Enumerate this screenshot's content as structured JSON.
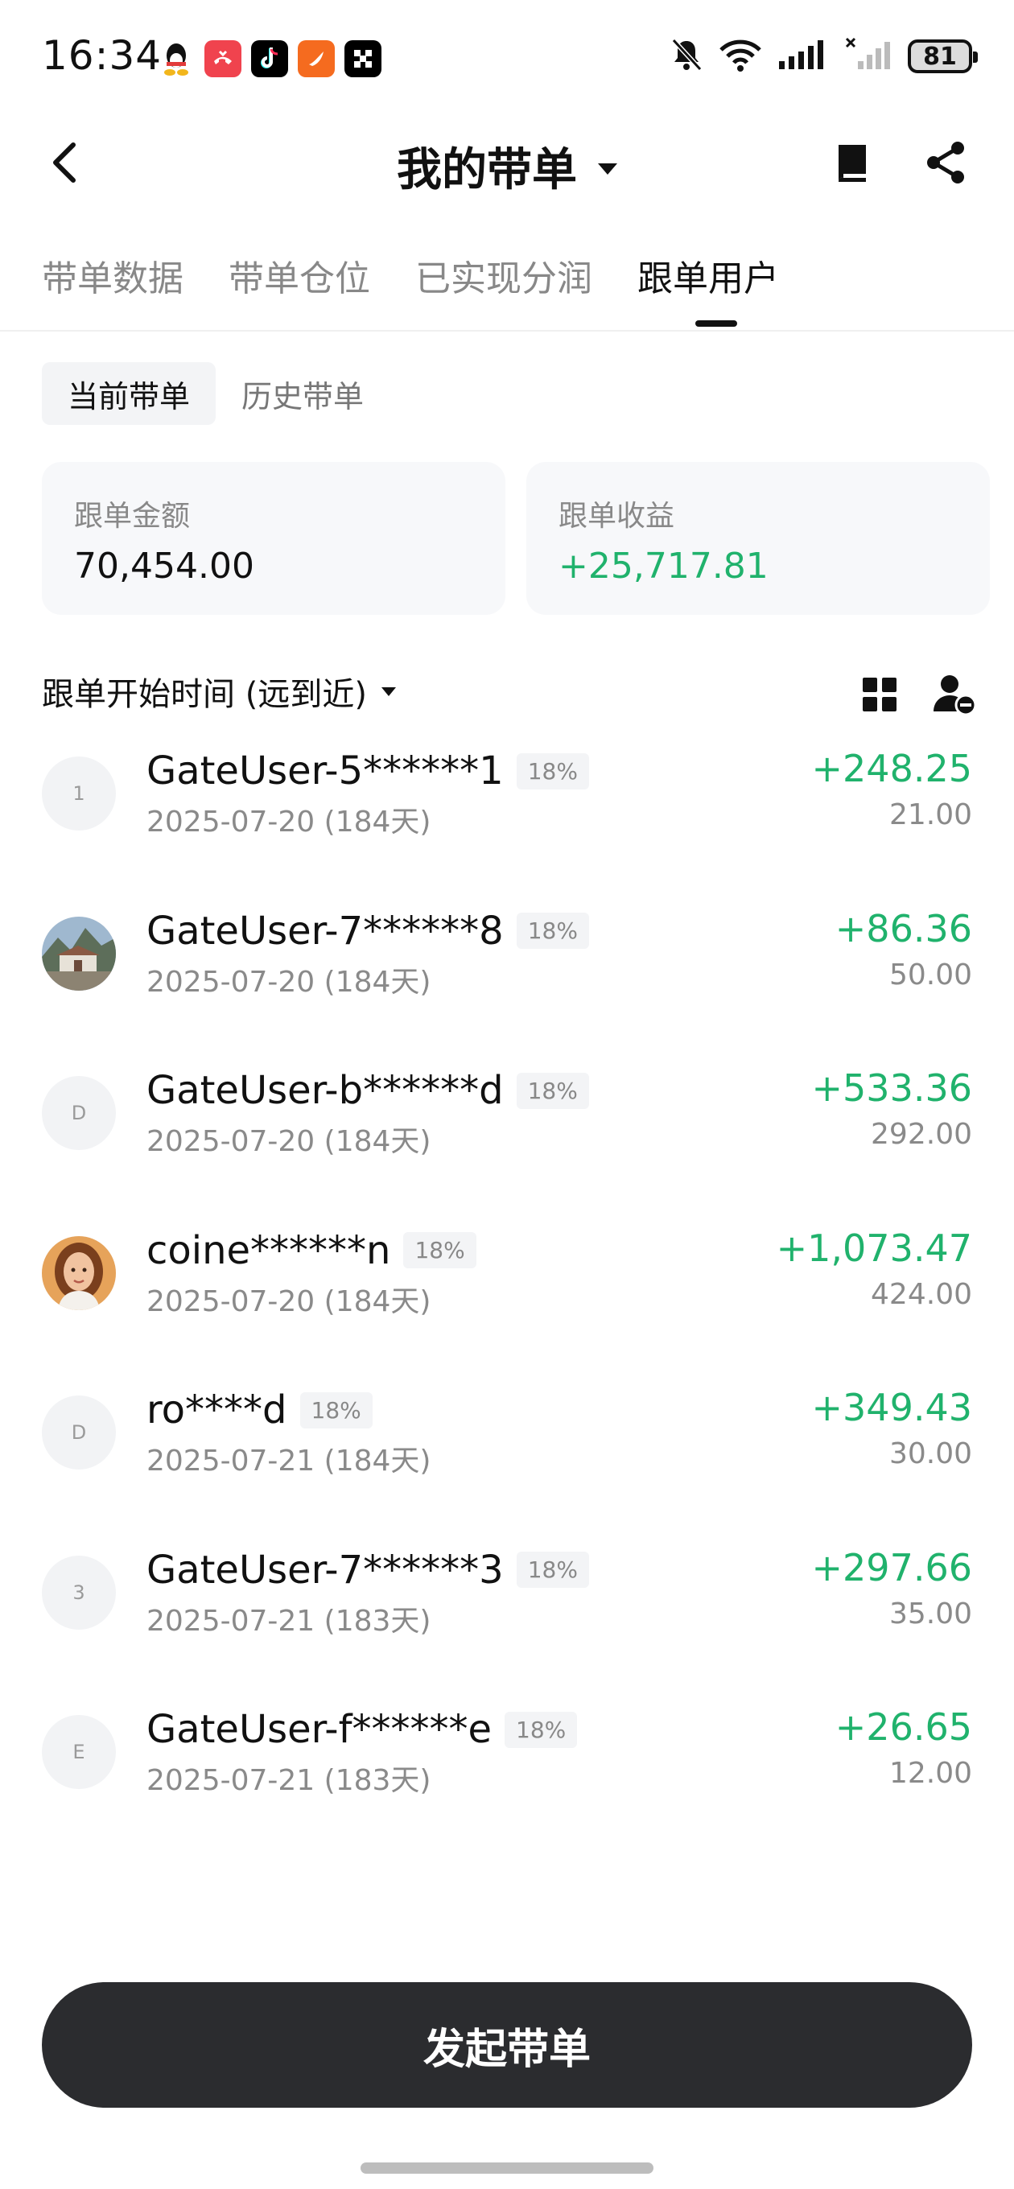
{
  "status_bar": {
    "time": "16:34",
    "battery": "81",
    "icons": [
      "qq-icon",
      "missed-call-icon",
      "tiktok-icon",
      "orange-app-icon",
      "square-app-icon",
      "mute-bell-icon",
      "wifi-icon",
      "signal-icon",
      "no-signal-icon"
    ]
  },
  "header": {
    "title": "我的带单"
  },
  "tabs": [
    {
      "label": "带单数据"
    },
    {
      "label": "带单仓位"
    },
    {
      "label": "已实现分润"
    },
    {
      "label": "跟单用户"
    }
  ],
  "segment": {
    "current": "当前带单",
    "history": "历史带单"
  },
  "stats": {
    "amount_label": "跟单金额",
    "amount_value": "70,454.00",
    "profit_label": "跟单收益",
    "profit_value": "+25,717.81"
  },
  "sort": {
    "label": "跟单开始时间 (远到近)"
  },
  "users": [
    {
      "avatar": "1",
      "name": "GateUser-5******1",
      "pct": "18%",
      "date": "2025-07-20 (184天)",
      "profit": "+248.25",
      "amount": "21.00"
    },
    {
      "avatar": "",
      "name": "GateUser-7******8",
      "pct": "18%",
      "date": "2025-07-20 (184天)",
      "profit": "+86.36",
      "amount": "50.00"
    },
    {
      "avatar": "D",
      "name": "GateUser-b******d",
      "pct": "18%",
      "date": "2025-07-20 (184天)",
      "profit": "+533.36",
      "amount": "292.00"
    },
    {
      "avatar": "",
      "name": "coine******n",
      "pct": "18%",
      "date": "2025-07-20 (184天)",
      "profit": "+1,073.47",
      "amount": "424.00"
    },
    {
      "avatar": "D",
      "name": "ro****d",
      "pct": "18%",
      "date": "2025-07-21 (184天)",
      "profit": "+349.43",
      "amount": "30.00"
    },
    {
      "avatar": "3",
      "name": "GateUser-7******3",
      "pct": "18%",
      "date": "2025-07-21 (183天)",
      "profit": "+297.66",
      "amount": "35.00"
    },
    {
      "avatar": "E",
      "name": "GateUser-f******e",
      "pct": "18%",
      "date": "2025-07-21 (183天)",
      "profit": "+26.65",
      "amount": "12.00"
    }
  ],
  "cta": {
    "label": "发起带单"
  },
  "colors": {
    "green": "#20b26c",
    "button": "#2b2c2f"
  }
}
